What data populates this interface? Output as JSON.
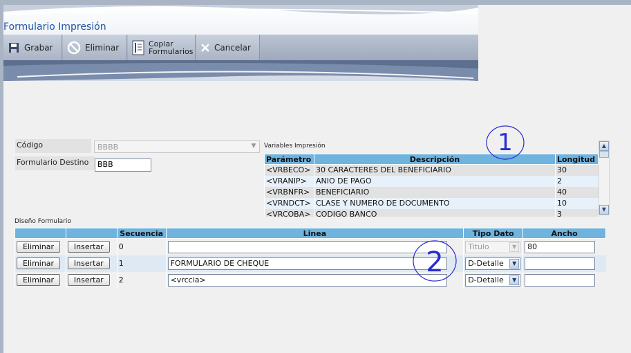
{
  "header": {
    "title": "Formulario Impresión"
  },
  "toolbar": {
    "grabar": "Grabar",
    "eliminar": "Eliminar",
    "copiar_line1": "Copiar",
    "copiar_line2": "Formularios",
    "cancelar": "Cancelar"
  },
  "form": {
    "codigo_label": "Código",
    "codigo_value": "BBBB",
    "destino_label": "Formulario Destino",
    "destino_value": "BBB"
  },
  "variables": {
    "caption": "Variables Impresión",
    "headers": [
      "Parámetro",
      "Descripción",
      "Longitud"
    ],
    "rows": [
      [
        "<VRBECO>",
        "30 CARACTERES DEL BENEFICIARIO",
        "30"
      ],
      [
        "<VRANIP>",
        "ANIO DE PAGO",
        "2"
      ],
      [
        "<VRBNFR>",
        "BENEFICIARIO",
        "40"
      ],
      [
        "<VRNDCT>",
        "CLASE Y NUMERO DE DOCUMENTO",
        "10"
      ],
      [
        "<VRCOBA>",
        "CODIGO BANCO",
        "3"
      ]
    ]
  },
  "design": {
    "caption": "Diseño Formulario",
    "headers": [
      "",
      "",
      "Secuencia",
      "Linea",
      "Tipo Dato",
      "Ancho"
    ],
    "eliminar_label": "Eliminar",
    "insertar_label": "Insertar",
    "rows": [
      {
        "secuencia": "0",
        "linea": "",
        "tipo": "Titulo",
        "ancho": "80"
      },
      {
        "secuencia": "1",
        "linea": "FORMULARIO DE CHEQUE",
        "tipo": "D-Detalle",
        "ancho": ""
      },
      {
        "secuencia": "2",
        "linea": "<vrccia>",
        "tipo": "D-Detalle",
        "ancho": ""
      }
    ]
  },
  "annotations": {
    "one": "1",
    "two": "2"
  },
  "colors": {
    "accent": "#1e56a8",
    "table_header": "#6fb3df",
    "annotation": "#2a2ad0"
  }
}
